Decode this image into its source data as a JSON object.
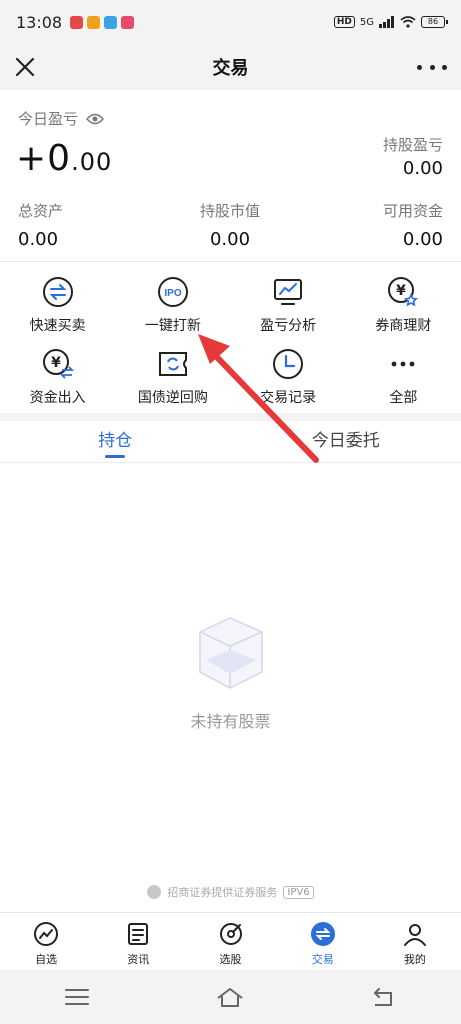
{
  "status_bar": {
    "time": "13:08",
    "hd": "HD",
    "network": "5G",
    "battery": "86"
  },
  "nav": {
    "title": "交易"
  },
  "summary": {
    "today_label": "今日盈亏",
    "today_value_main": "+0",
    "today_value_frac": ".00",
    "hold_label": "持股盈亏",
    "hold_value": "0.00",
    "total_assets_label": "总资产",
    "total_assets_value": "0.00",
    "market_value_label": "持股市值",
    "market_value_value": "0.00",
    "available_label": "可用资金",
    "available_value": "0.00"
  },
  "functions": [
    {
      "label": "快速买卖",
      "icon": "swap-icon"
    },
    {
      "label": "一键打新",
      "icon": "ipo-icon",
      "icon_text": "IPO"
    },
    {
      "label": "盈亏分析",
      "icon": "chart-monitor-icon"
    },
    {
      "label": "券商理财",
      "icon": "yen-star-icon"
    },
    {
      "label": "资金出入",
      "icon": "yen-transfer-icon"
    },
    {
      "label": "国债逆回购",
      "icon": "bond-repo-icon"
    },
    {
      "label": "交易记录",
      "icon": "clock-icon"
    },
    {
      "label": "全部",
      "icon": "more-dots-icon"
    }
  ],
  "tabs": [
    {
      "label": "持仓",
      "active": true
    },
    {
      "label": "今日委托",
      "active": false
    }
  ],
  "empty": {
    "text": "未持有股票"
  },
  "provider": {
    "text": "招商证券提供证券服务",
    "badge": "IPV6"
  },
  "bottom_nav": [
    {
      "label": "自选",
      "icon": "trend-icon"
    },
    {
      "label": "资讯",
      "icon": "news-icon"
    },
    {
      "label": "选股",
      "icon": "stock-pick-icon"
    },
    {
      "label": "交易",
      "icon": "trade-icon",
      "active": true
    },
    {
      "label": "我的",
      "icon": "user-icon"
    }
  ],
  "colors": {
    "accent": "#2c6ed6",
    "annotation_arrow": "#e8393a"
  }
}
